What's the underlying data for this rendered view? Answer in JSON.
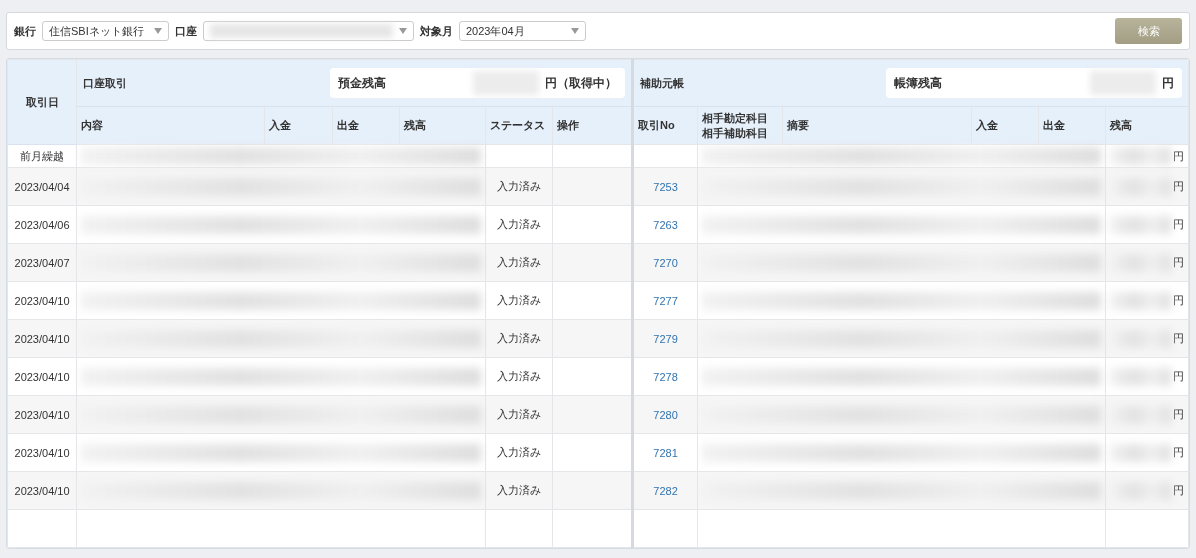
{
  "filters": {
    "bank": {
      "label": "銀行",
      "value": "住信SBIネット銀行"
    },
    "account": {
      "label": "口座"
    },
    "month": {
      "label": "対象月",
      "value": "2023年04月"
    },
    "search_button": "検索"
  },
  "table": {
    "date_header": "取引日",
    "account_section": {
      "title": "口座取引",
      "balance_label": "預金残高",
      "balance_suffix": "円（取得中）"
    },
    "ledger_section": {
      "title": "補助元帳",
      "balance_label": "帳簿残高",
      "balance_suffix": "円"
    },
    "account_columns": [
      "内容",
      "入金",
      "出金",
      "残高",
      "ステータス",
      "操作"
    ],
    "ledger_columns": [
      "取引No",
      "相手勘定科目相手補助科目",
      "摘要",
      "入金",
      "出金",
      "残高"
    ],
    "rows": [
      {
        "date": "前月繰越",
        "balance_unit": "円"
      },
      {
        "date": "2023/04/04",
        "status": "入力済み",
        "transaction_no": "7253",
        "balance_unit": "円"
      },
      {
        "date": "2023/04/06",
        "status": "入力済み",
        "transaction_no": "7263",
        "balance_unit": "円"
      },
      {
        "date": "2023/04/07",
        "status": "入力済み",
        "transaction_no": "7270",
        "balance_unit": "円"
      },
      {
        "date": "2023/04/10",
        "status": "入力済み",
        "transaction_no": "7277",
        "balance_unit": "円"
      },
      {
        "date": "2023/04/10",
        "status": "入力済み",
        "transaction_no": "7279",
        "balance_unit": "円"
      },
      {
        "date": "2023/04/10",
        "status": "入力済み",
        "transaction_no": "7278",
        "balance_unit": "円"
      },
      {
        "date": "2023/04/10",
        "status": "入力済み",
        "transaction_no": "7280",
        "balance_unit": "円"
      },
      {
        "date": "2023/04/10",
        "status": "入力済み",
        "transaction_no": "7281",
        "balance_unit": "円"
      },
      {
        "date": "2023/04/10",
        "status": "入力済み",
        "transaction_no": "7282",
        "balance_unit": "円"
      }
    ]
  }
}
